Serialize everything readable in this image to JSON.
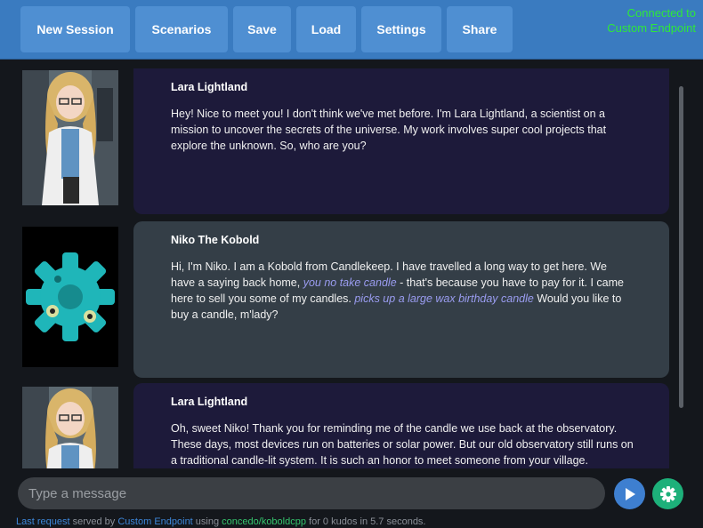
{
  "toolbar": {
    "buttons": [
      "New Session",
      "Scenarios",
      "Save",
      "Load",
      "Settings",
      "Share"
    ],
    "status": "Connected to Custom Endpoint"
  },
  "messages": [
    {
      "name": "Lara Lightland",
      "text": "Hey! Nice to meet you! I don't think we've met before. I'm Lara Lightland, a scientist on a mission to uncover the secrets of the universe. My work involves super cool projects that explore the unknown. So, who are you?"
    },
    {
      "name": "Niko The Kobold",
      "text_1": "Hi, I'm Niko. I am a Kobold from Candlekeep. I have travelled a long way to get here. We have a saying back home, ",
      "em_1": "you no take candle",
      "text_2": " - that's because you have to pay for it. I came here to sell you some of my candles. ",
      "em_2": "picks up a large wax birthday candle",
      "text_3": " Would you like to buy a candle, m'lady?"
    },
    {
      "name": "Lara Lightland",
      "text": "Oh, sweet Niko! Thank you for reminding me of the candle we use back at the observatory. These days, most devices run on batteries or solar power. But our old observatory still runs on a traditional candle-lit system. It is such an honor to meet someone from your village."
    }
  ],
  "input": {
    "placeholder": "Type a message"
  },
  "footer": {
    "link_1": "Last request",
    "text_1": " served by ",
    "link_2": "Custom Endpoint",
    "text_2": " using ",
    "model": "concedo/koboldcpp",
    "text_3": " for 0 kudos in 5.7 seconds."
  },
  "icons": {
    "send": "play-arrow-icon",
    "settings": "gear-icon",
    "accent": "#3a7bc0",
    "status_color": "#2ee83a"
  }
}
